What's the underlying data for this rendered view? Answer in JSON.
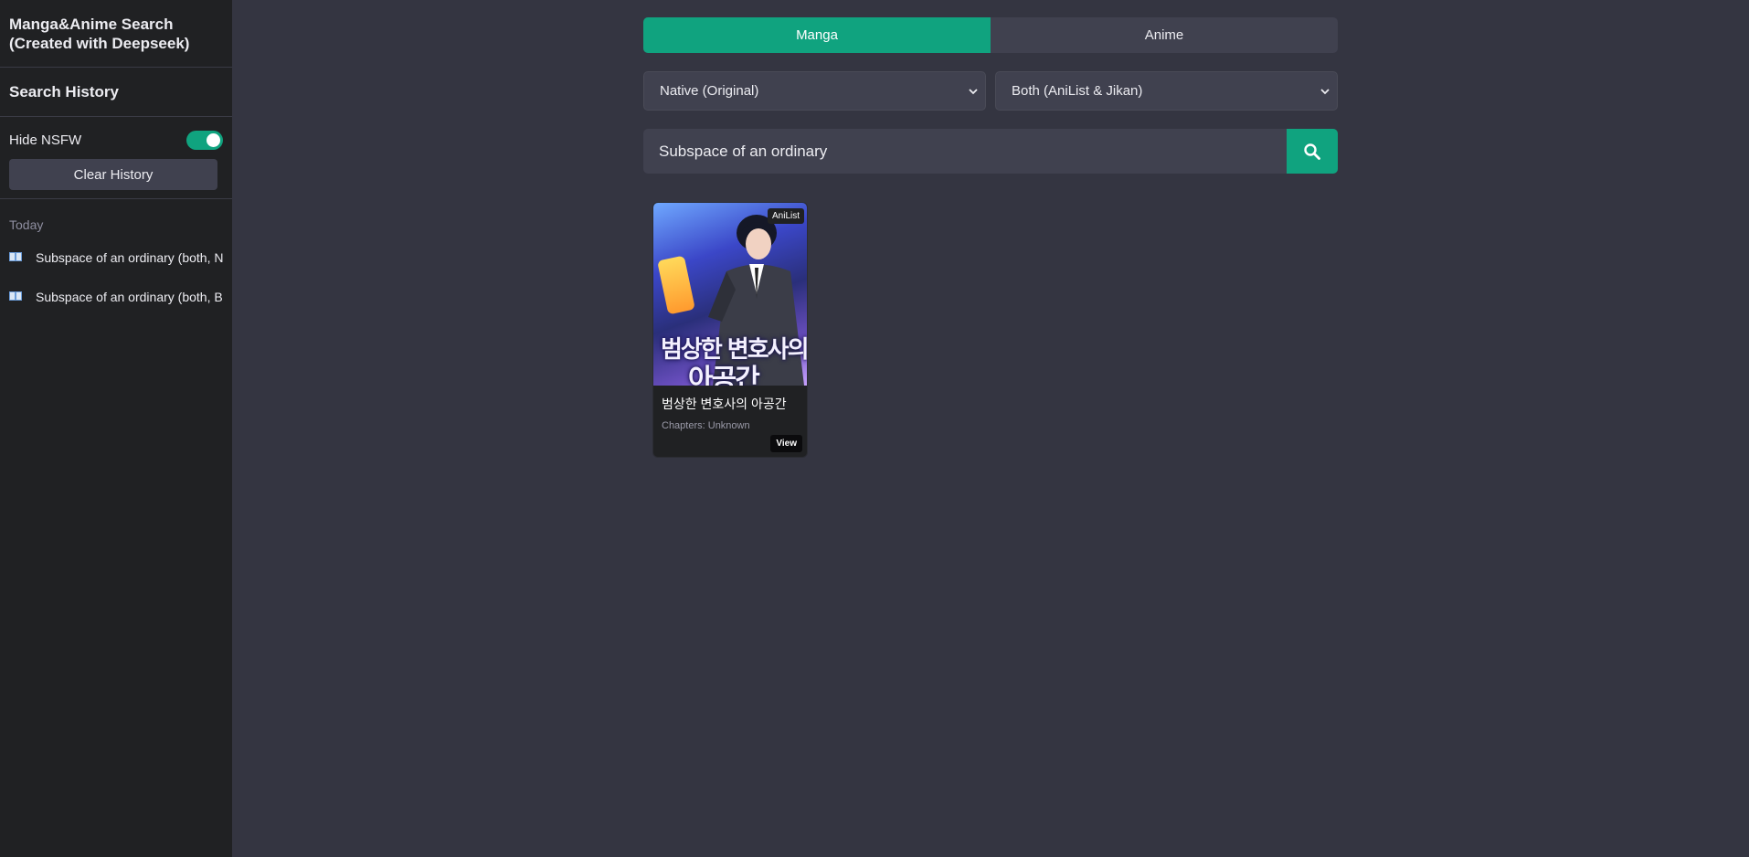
{
  "sidebar": {
    "title": "Manga&Anime Search (Created with Deepseek)",
    "history_heading": "Search History",
    "hide_nsfw_label": "Hide NSFW",
    "hide_nsfw_on": true,
    "clear_button": "Clear History",
    "group_label": "Today",
    "items": [
      {
        "label": "Subspace of an ordinary (both, N",
        "icon": "book-icon"
      },
      {
        "label": "Subspace of an ordinary (both, B",
        "icon": "book-icon"
      }
    ]
  },
  "tabs": [
    {
      "label": "Manga",
      "active": true
    },
    {
      "label": "Anime",
      "active": false
    }
  ],
  "filters": {
    "title_language": "Native (Original)",
    "source": "Both (AniList & Jikan)"
  },
  "search": {
    "value": "Subspace of an ordinary",
    "button_icon": "search-icon"
  },
  "results": [
    {
      "title": "범상한 변호사의 아공간",
      "meta": "Chapters: Unknown",
      "badge": "AniList",
      "view_label": "View",
      "cover_text_line1": "범상한 변호사의",
      "cover_text_line2": "아공간"
    }
  ],
  "colors": {
    "accent": "#10a37f",
    "sidebar_bg": "#202123",
    "main_bg": "#343541",
    "control_bg": "#40414f"
  }
}
